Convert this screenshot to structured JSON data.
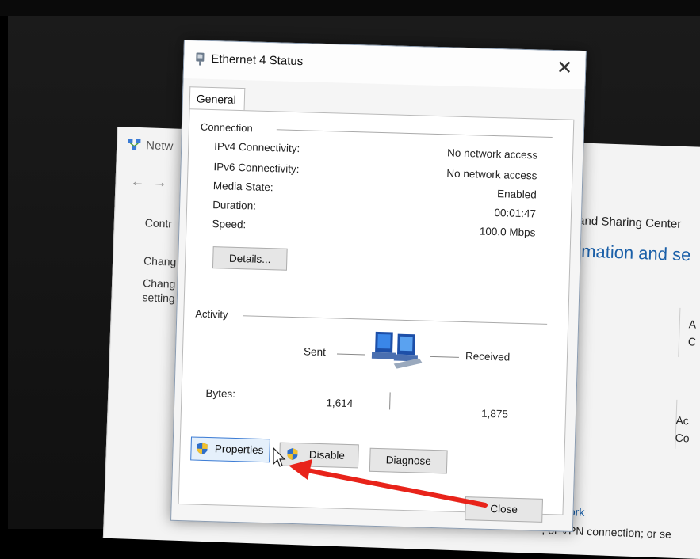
{
  "background_window": {
    "title": "Netw",
    "left_links": [
      "Contr",
      "Chang",
      "Chang",
      "setting"
    ],
    "breadcrumb": "and Sharing Center",
    "heading": "rmation and se",
    "side_texts": [
      "A",
      "C",
      "Ac",
      "Co"
    ],
    "setup_link": "network",
    "vpn_text": ", or VPN connection; or se"
  },
  "dialog": {
    "title": "Ethernet 4 Status",
    "close_glyph": "✕",
    "tab_general": "General",
    "connection": {
      "label": "Connection",
      "rows": [
        {
          "label": "IPv4 Connectivity:",
          "value": "No network access"
        },
        {
          "label": "IPv6 Connectivity:",
          "value": "No network access"
        },
        {
          "label": "Media State:",
          "value": "Enabled"
        },
        {
          "label": "Duration:",
          "value": "00:01:47"
        },
        {
          "label": "Speed:",
          "value": "100.0 Mbps"
        }
      ],
      "details_button": "Details..."
    },
    "activity": {
      "label": "Activity",
      "sent_label": "Sent",
      "received_label": "Received",
      "bytes_label": "Bytes:",
      "bytes_sent": "1,614",
      "bytes_received": "1,875"
    },
    "buttons": {
      "properties": "Properties",
      "disable": "Disable",
      "diagnose": "Diagnose",
      "close": "Close"
    }
  },
  "colors": {
    "annotation_arrow": "#e8231a",
    "link_blue": "#1a5fa8",
    "shield_blue": "#2f6fc9",
    "shield_yellow": "#f2c12e"
  }
}
